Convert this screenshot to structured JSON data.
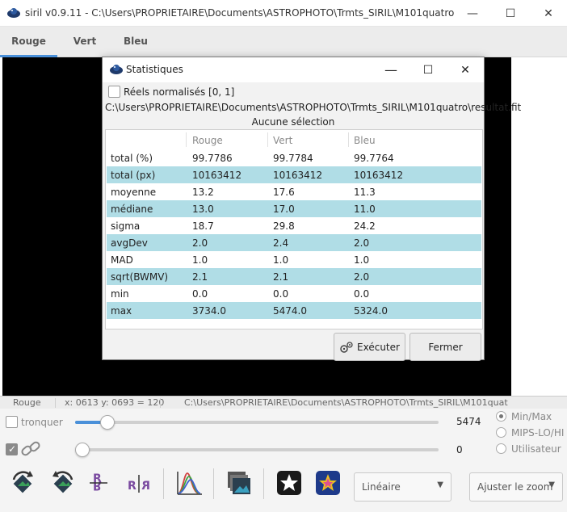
{
  "window": {
    "title": "siril v0.9.11 - C:\\Users\\PROPRIETAIRE\\Documents\\ASTROPHOTO\\Trmts_SIRIL\\M101quatro",
    "minimize": "—",
    "maximize": "☐",
    "close": "✕"
  },
  "tabs": [
    {
      "label": "Rouge",
      "active": true
    },
    {
      "label": "Vert",
      "active": false
    },
    {
      "label": "Bleu",
      "active": false
    }
  ],
  "statusbar": {
    "channel": "Rouge",
    "coords": "x: 0613 y: 0693 = 120",
    "path": "C:\\Users\\PROPRIETAIRE\\Documents\\ASTROPHOTO\\Trmts_SIRIL\\M101quat"
  },
  "controls": {
    "clip_label": "tronquer",
    "upper_value": "5474",
    "lower_value": "0",
    "upper_fraction": 0.07,
    "lower_fraction": 0.0,
    "radio_options": [
      {
        "label": "Min/Max",
        "selected": true
      },
      {
        "label": "MIPS-LO/HI",
        "selected": false
      },
      {
        "label": "Utilisateur",
        "selected": false
      }
    ],
    "scale_combo": "Linéaire",
    "zoom_combo": "Ajuster le zoom"
  },
  "dialog": {
    "title": "Statistiques",
    "maximize": "☐",
    "close": "✕",
    "normalized_label": "Réels normalisés [0, 1]",
    "path": "C:\\Users\\PROPRIETAIRE\\Documents\\ASTROPHOTO\\Trmts_SIRIL\\M101quatro\\resultat.fit",
    "selection": "Aucune sélection",
    "headers": [
      "",
      "Rouge",
      "Vert",
      "Bleu"
    ],
    "rows": [
      [
        "total (%)",
        "99.7786",
        "99.7784",
        "99.7764"
      ],
      [
        "total (px)",
        "10163412",
        "10163412",
        "10163412"
      ],
      [
        "moyenne",
        "13.2",
        "17.6",
        "11.3"
      ],
      [
        "médiane",
        "13.0",
        "17.0",
        "11.0"
      ],
      [
        "sigma",
        "18.7",
        "29.8",
        "24.2"
      ],
      [
        "avgDev",
        "2.0",
        "2.4",
        "2.0"
      ],
      [
        "MAD",
        "1.0",
        "1.0",
        "1.0"
      ],
      [
        "sqrt(BWMV)",
        "2.1",
        "2.1",
        "2.0"
      ],
      [
        "min",
        "0.0",
        "0.0",
        "0.0"
      ],
      [
        "max",
        "3734.0",
        "5474.0",
        "5324.0"
      ]
    ],
    "execute_label": "Exécuter",
    "close_label": "Fermer"
  },
  "colors": {
    "row_highlight": "#b0dde6",
    "accent": "#4a90d9"
  }
}
